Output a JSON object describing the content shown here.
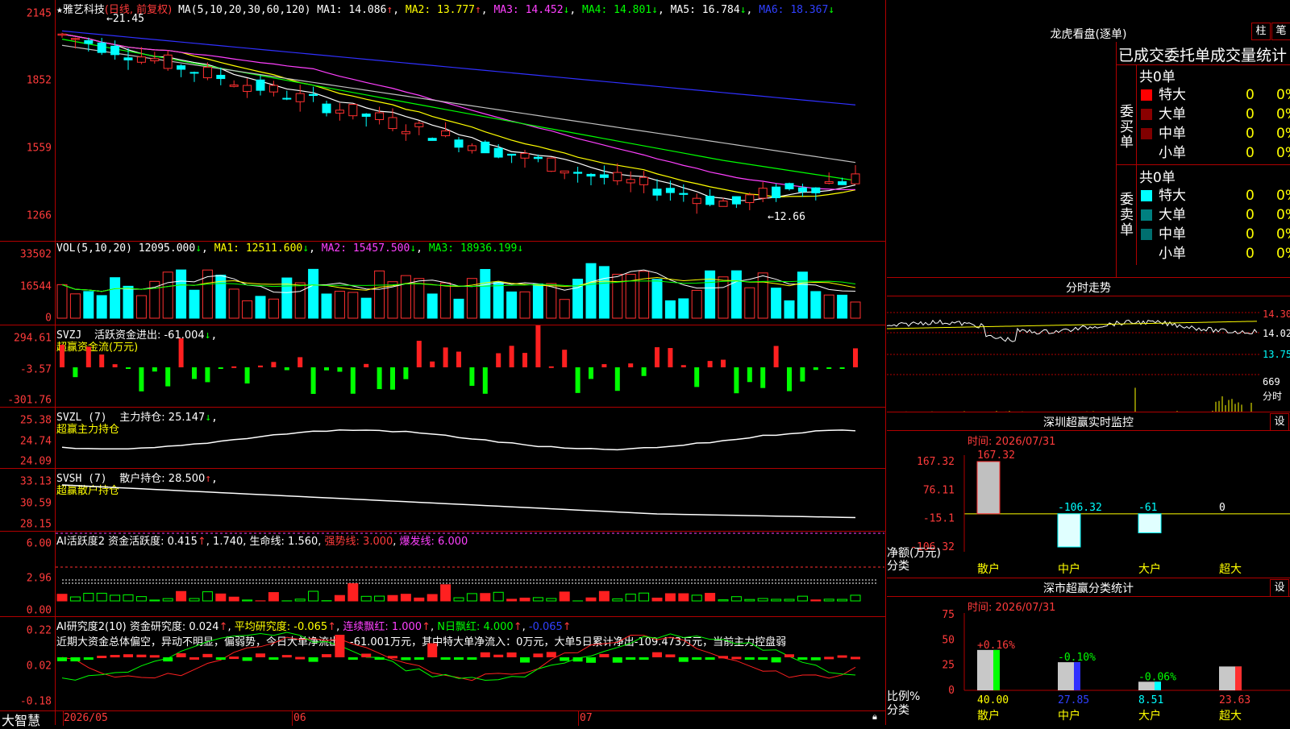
{
  "stock": {
    "star": "★",
    "name": "雅艺科技",
    "period": "(日线, 前复权)",
    "ma_label": "MA(5,10,20,30,60,120)",
    "ma1": "MA1: 14.086",
    "ma1_arrow": "↑",
    "ma2": "MA2: 13.777",
    "ma2_arrow": "↑",
    "ma3": "MA3: 14.452",
    "ma3_arrow": "↓",
    "ma4": "MA4: 14.801",
    "ma4_arrow": "↓",
    "ma5": "MA5: 16.784",
    "ma5_arrow": "↓",
    "ma6": "MA6: 18.367",
    "ma6_arrow": "↓",
    "high_label": "21.45",
    "low_label": "12.66",
    "y_ticks": [
      "2145",
      "1852",
      "1559",
      "1266"
    ]
  },
  "vol": {
    "label": "VOL(5,10,20)",
    "value": "12095.000",
    "arrow": "↓",
    "ma1": "MA1: 12511.600",
    "ma1_arrow": "↓",
    "ma2": "MA2: 15457.500",
    "ma2_arrow": "↓",
    "ma3": "MA3: 18936.199",
    "ma3_arrow": "↓",
    "y_ticks": [
      "33502",
      "16544",
      "0"
    ]
  },
  "svzj": {
    "label": "SVZJ",
    "text": "活跃资金进出: -61.004",
    "arrow": "↓",
    "sub": "超赢资金流(万元)",
    "y_ticks": [
      "294.61",
      "-3.57",
      "-301.76"
    ]
  },
  "svzl": {
    "label": "SVZL (7)",
    "text": "主力持仓: 25.147",
    "arrow": "↓",
    "sub": "超赢主力持仓",
    "y_ticks": [
      "25.38",
      "24.74",
      "24.09"
    ]
  },
  "svsh": {
    "label": "SVSH (7)",
    "text": "散户持仓: 28.500",
    "arrow": "↑",
    "sub": "超赢散户持仓",
    "y_ticks": [
      "33.13",
      "30.59",
      "28.15"
    ]
  },
  "ai1": {
    "label": "AI活跃度2",
    "text1": "资金活跃度: 0.415",
    "a1": "↑",
    "text2": "1.740",
    "text3": "生命线: 1.560",
    "text4": "强势线: 3.000",
    "text5": "爆发线: 6.000",
    "y_ticks": [
      "6.00",
      "2.96",
      "0.00"
    ]
  },
  "ai2": {
    "label": "AI研究度2(10)",
    "text1": "资金研究度: 0.024",
    "a1": "↑",
    "text2": "平均研究度: -0.065",
    "a2": "↑",
    "text3": "连续飘红: 1.000",
    "a3": "↑",
    "text4": "N日飘红: 4.000",
    "a4": "↑",
    "text5": "-0.065",
    "a5": "↑",
    "comment": "近期大资金总体偏空，异动不明显，偏弱势，今日大单净流出：-61.001万元，其中特大单净流入：0万元，大单5日累计净出-109.473万元，当前主力控盘弱",
    "y_ticks": [
      "0.22",
      "0.02",
      "-0.18"
    ]
  },
  "xaxis": {
    "brand": "大智慧",
    "labels": [
      "2026/05",
      "06",
      "07"
    ]
  },
  "right": {
    "lhb": {
      "title": "龙虎看盘(逐单)",
      "btn1": "柱",
      "btn2": "笔",
      "sub": "已成交委托单成交量统计",
      "buy": {
        "side": "委买单",
        "total": "共0单",
        "rows": [
          {
            "name": "特大",
            "color": "#ff0000",
            "v": "0",
            "p": "0%"
          },
          {
            "name": "大单",
            "color": "#8b0000",
            "v": "0",
            "p": "0%"
          },
          {
            "name": "中单",
            "color": "#800000",
            "v": "0",
            "p": "0%"
          },
          {
            "name": "小单",
            "color": "#000000",
            "v": "0",
            "p": "0%"
          }
        ]
      },
      "sell": {
        "side": "委卖单",
        "total": "共0单",
        "rows": [
          {
            "name": "特大",
            "color": "#00ffff",
            "v": "0",
            "p": "0%"
          },
          {
            "name": "大单",
            "color": "#008080",
            "v": "0",
            "p": "0%"
          },
          {
            "name": "中单",
            "color": "#006f6f",
            "v": "0",
            "p": "0%"
          },
          {
            "name": "小单",
            "color": "#000000",
            "v": "0",
            "p": "0%"
          }
        ]
      }
    },
    "intraday": {
      "title": "分时走势",
      "prices": [
        "14.30",
        "14.02",
        "13.75"
      ],
      "vol": "669",
      "vol_unit": "分时"
    },
    "monitor": {
      "title": "深圳超赢实时监控",
      "btn": "设",
      "time": "时间: 2026/07/31",
      "y_ticks": [
        "167.32",
        "76.11",
        "-15.1",
        "-106.32"
      ],
      "ylabel1": "净额(万元)",
      "ylabel2": "分类",
      "bars": [
        {
          "cat": "散户",
          "value": 167.32,
          "label": "167.32"
        },
        {
          "cat": "中户",
          "value": -106.32,
          "label": "-106.32"
        },
        {
          "cat": "大户",
          "value": -61,
          "label": "-61"
        },
        {
          "cat": "超大",
          "value": 0,
          "label": "0"
        }
      ]
    },
    "category": {
      "title": "深市超赢分类统计",
      "btn": "设",
      "time": "时间: 2026/07/31",
      "y_ticks": [
        "75",
        "50",
        "25",
        "0"
      ],
      "ylabel1": "比例%",
      "ylabel2": "分类",
      "bars": [
        {
          "cat": "散户",
          "value": 40.0,
          "label": "40.00",
          "delta": "+0.16%",
          "color": "#00ff00"
        },
        {
          "cat": "中户",
          "value": 27.85,
          "label": "27.85",
          "delta": "-0.10%",
          "color": "#3030ff"
        },
        {
          "cat": "大户",
          "value": 8.51,
          "label": "8.51",
          "delta": "-0.06%",
          "color": "#00ffff"
        },
        {
          "cat": "超大",
          "value": 23.63,
          "label": "23.63",
          "delta": "",
          "color": "#ff3030"
        }
      ]
    }
  }
}
